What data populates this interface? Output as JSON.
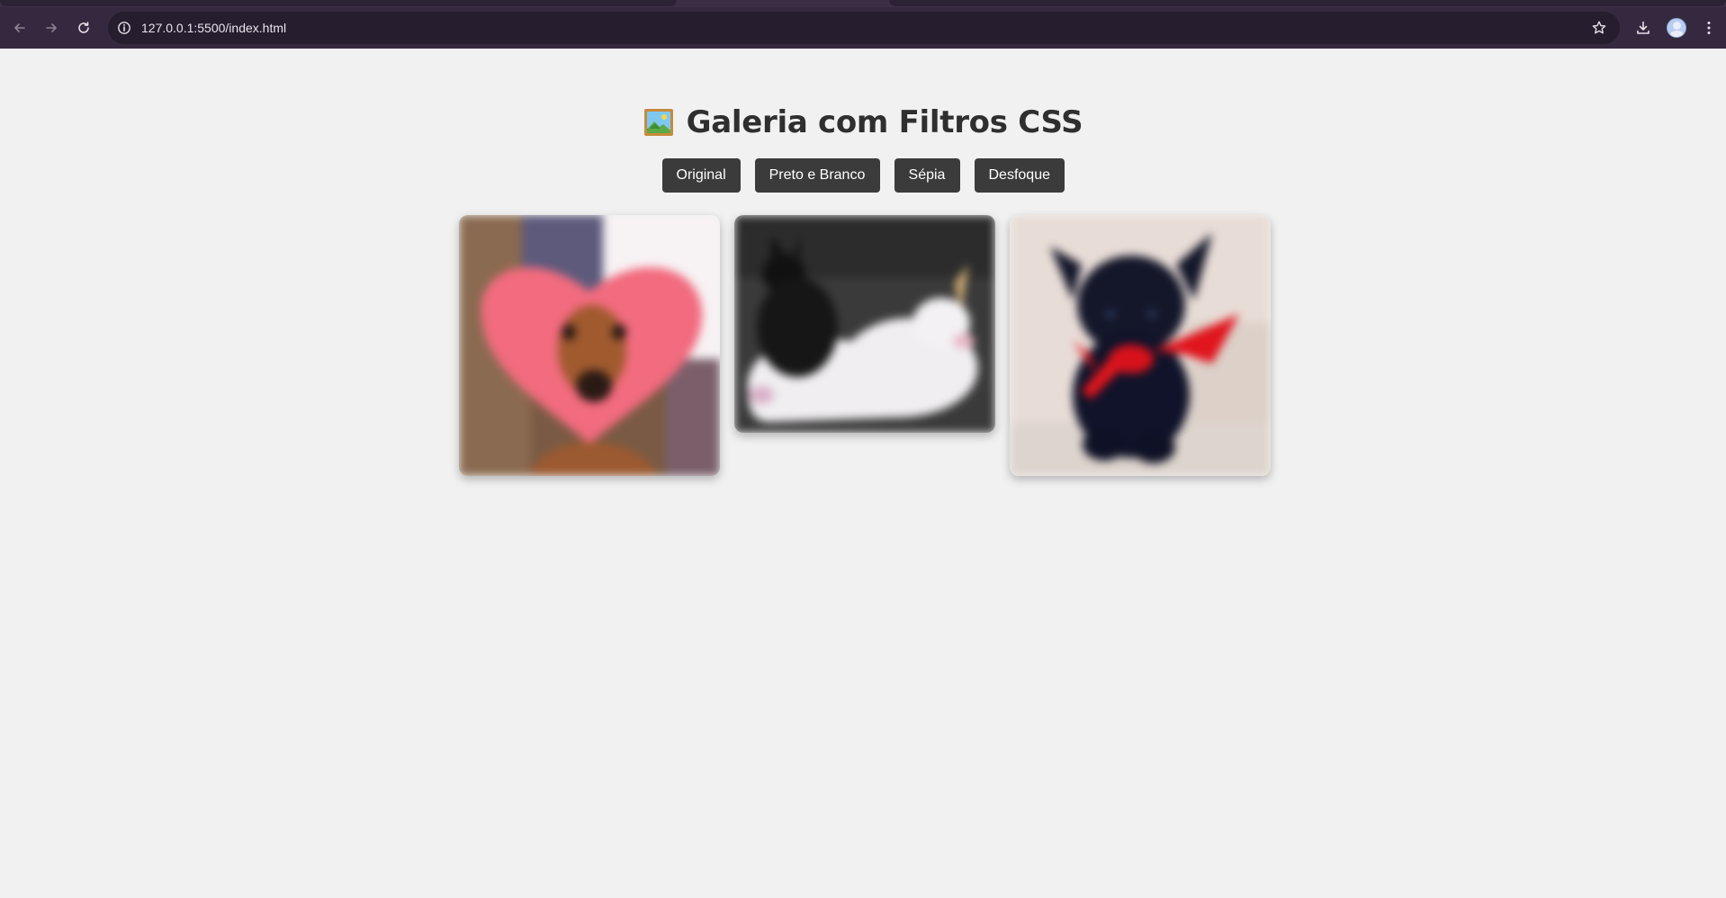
{
  "browser": {
    "url": "127.0.0.1:5500/index.html",
    "icons": {
      "back": "arrow-left-icon",
      "forward": "arrow-right-icon",
      "reload": "reload-icon",
      "site_info": "info-icon",
      "bookmark": "star-icon",
      "downloads": "download-icon",
      "profile": "avatar",
      "menu": "kebab-menu-icon"
    }
  },
  "page": {
    "title_icon": "framed-picture-icon",
    "title": "Galeria com Filtros CSS",
    "filters": [
      {
        "label": "Original"
      },
      {
        "label": "Preto e Branco"
      },
      {
        "label": "Sépia"
      },
      {
        "label": "Desfoque"
      }
    ],
    "active_filter": "Desfoque",
    "gallery": [
      {
        "subject": "dog-with-pink-heart-image"
      },
      {
        "subject": "black-cat-on-unicorn-plush-image"
      },
      {
        "subject": "black-kitten-with-red-bow-image"
      }
    ]
  },
  "colors": {
    "chrome": "#35293f",
    "omnibox": "#261d2e",
    "page_background": "#f1f1f1",
    "button_background": "#3b3b3b",
    "button_text": "#ffffff",
    "heading_text": "#2f2f2f"
  }
}
